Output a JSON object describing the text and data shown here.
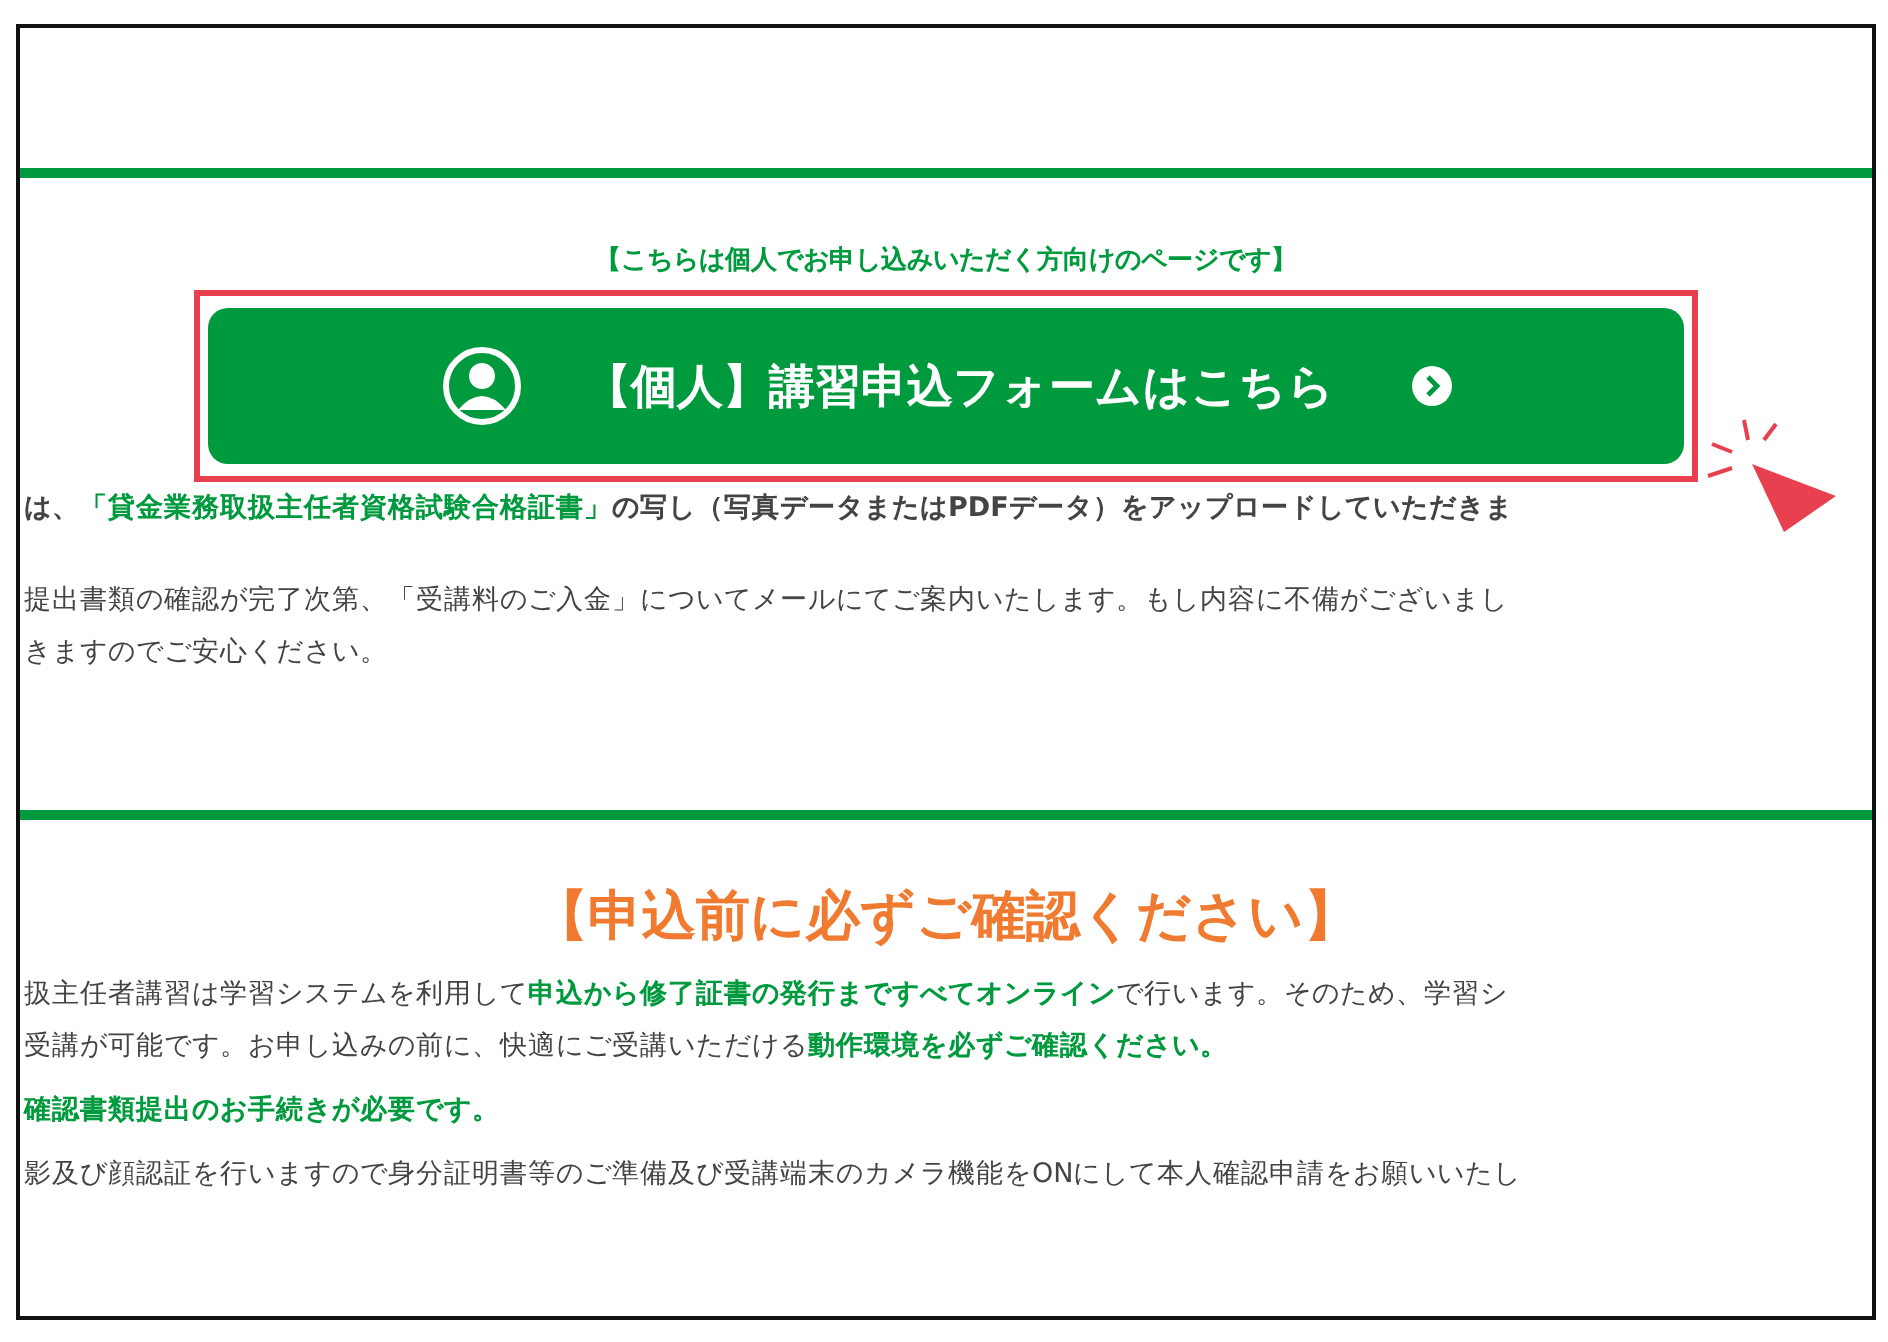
{
  "notice": "【こちらは個人でお申し込みいただく方向けのページです】",
  "form_button": {
    "label": "【個人】講習申込フォームはこちら",
    "highlighted": true
  },
  "upload_line": "は、**「貸金業務取扱主任者資格試験合格証書」**の写し（写真データまたはPDFデータ）をアップロードしていただきま",
  "confirm_lines": [
    "提出書類の確認が完了次第、「受講料のご入金」についてメールにてご案内いたします。もし内容に不備がございまし",
    "きますのでご安心ください。"
  ],
  "heading": "【申込前に必ずご確認ください】",
  "intro_lines": [
    "扱主任者講習は学習システムを利用して**申込から修了証書の発行まですべてオンライン**で行います。そのため、学習シ",
    "受講が可能です。お申し込みの前に、快適にご受講いただける**動作環境を必ずご確認ください。**"
  ],
  "subheading": "確認書類提出のお手続きが必要です。",
  "id_line": "影及び顔認証を行いますので身分証明書等のご準備及び受講端末のカメラ機能をONにして本人確認申請をお願いいたし"
}
